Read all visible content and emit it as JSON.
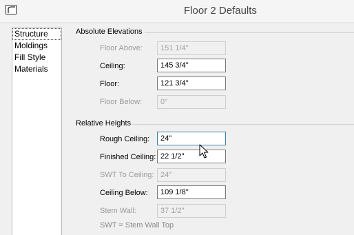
{
  "window": {
    "title": "Floor 2 Defaults"
  },
  "nav": {
    "items": [
      "Structure",
      "Moldings",
      "Fill Style",
      "Materials"
    ],
    "selected": "Structure"
  },
  "absolute_elevations": {
    "title": "Absolute Elevations",
    "floor_above": {
      "label": "Floor Above:",
      "value": "151 1/4\""
    },
    "ceiling": {
      "label": "Ceiling:",
      "value": "145 3/4\""
    },
    "floor": {
      "label": "Floor:",
      "value": "121 3/4\""
    },
    "floor_below": {
      "label": "Floor Below:",
      "value": "0\""
    }
  },
  "relative_heights": {
    "title": "Relative Heights",
    "rough_ceiling": {
      "label": "Rough Ceiling:",
      "value": "24\""
    },
    "finished_ceiling": {
      "label": "Finished Ceiling:",
      "value": "22 1/2\""
    },
    "swt_to_ceiling": {
      "label": "SWT To Ceiling:",
      "value": "24\""
    },
    "ceiling_below": {
      "label": "Ceiling Below:",
      "value": "109 1/8\""
    },
    "stem_wall": {
      "label": "Stem Wall:",
      "value": "37 1/2\""
    },
    "note": "SWT = Stem Wall Top"
  },
  "icons": {
    "app": "app-icon",
    "cursor": "mouse-pointer-icon"
  }
}
